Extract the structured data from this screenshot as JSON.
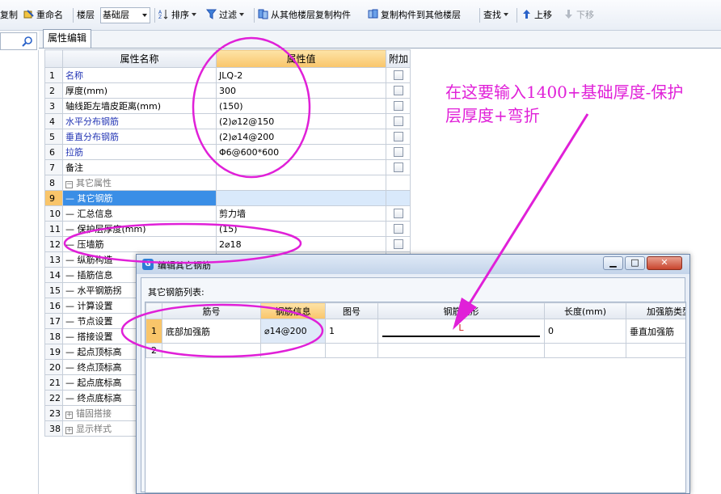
{
  "toolbar": {
    "copy": "复制",
    "rename": "重命名",
    "floor_label": "楼层",
    "floor_value": "基础层",
    "sort": "排序",
    "filter": "过滤",
    "copy_from_other_floor": "从其他楼层复制构件",
    "copy_to_other_floor": "复制构件到其他楼层",
    "find": "查找",
    "move_up": "上移",
    "move_down": "下移"
  },
  "tab": {
    "label": "属性编辑"
  },
  "grid": {
    "headers": {
      "name": "属性名称",
      "value": "属性值",
      "extra": "附加"
    },
    "rows": [
      {
        "num": "1",
        "name": "名称",
        "value": "JLQ-2"
      },
      {
        "num": "2",
        "name": "厚度(mm)",
        "value": "300"
      },
      {
        "num": "3",
        "name": "轴线距左墙皮距离(mm)",
        "value": "(150)"
      },
      {
        "num": "4",
        "name": "水平分布钢筋",
        "value": "(2)⌀12@150"
      },
      {
        "num": "5",
        "name": "垂直分布钢筋",
        "value": "(2)⌀14@200"
      },
      {
        "num": "6",
        "name": "拉筋",
        "value": "Φ6@600*600"
      },
      {
        "num": "7",
        "name": "备注",
        "value": ""
      },
      {
        "num": "8",
        "name": "其它属性",
        "value": ""
      },
      {
        "num": "9",
        "name": "其它钢筋",
        "value": ""
      },
      {
        "num": "10",
        "name": "汇总信息",
        "value": "剪力墙"
      },
      {
        "num": "11",
        "name": "保护层厚度(mm)",
        "value": "(15)"
      },
      {
        "num": "12",
        "name": "压墙筋",
        "value": "2⌀18"
      },
      {
        "num": "13",
        "name": "纵筋构造",
        "value": ""
      },
      {
        "num": "14",
        "name": "插筋信息",
        "value": ""
      },
      {
        "num": "15",
        "name": "水平钢筋拐",
        "value": ""
      },
      {
        "num": "16",
        "name": "计算设置",
        "value": ""
      },
      {
        "num": "17",
        "name": "节点设置",
        "value": ""
      },
      {
        "num": "18",
        "name": "搭接设置",
        "value": ""
      },
      {
        "num": "19",
        "name": "起点顶标高",
        "value": ""
      },
      {
        "num": "20",
        "name": "终点顶标高",
        "value": ""
      },
      {
        "num": "21",
        "name": "起点底标高",
        "value": ""
      },
      {
        "num": "22",
        "name": "终点底标高",
        "value": ""
      },
      {
        "num": "23",
        "name": "锚固搭接",
        "value": ""
      },
      {
        "num": "38",
        "name": "显示样式",
        "value": ""
      }
    ]
  },
  "annotation": {
    "line1": "在这要输入1400+基础厚度-保护",
    "line2": "层厚度+弯折"
  },
  "dialog": {
    "title": "编辑其它钢筋",
    "list_label": "其它钢筋列表:",
    "headers": {
      "bar_no": "筋号",
      "bar_info": "钢筋信息",
      "shape_no": "图号",
      "shape": "钢筋图形",
      "length": "长度(mm)",
      "type": "加强筋类型"
    },
    "rows": [
      {
        "num": "1",
        "bar_no": "底部加强筋",
        "bar_info": "⌀14@200",
        "shape_no": "1",
        "shape_label": "L",
        "length": "0",
        "type": "垂直加强筋"
      },
      {
        "num": "2",
        "bar_no": "",
        "bar_info": "",
        "shape_no": "",
        "shape_label": "",
        "length": "",
        "type": ""
      }
    ]
  },
  "colors": {
    "annotation": "#e020d8",
    "accent_header": "#f9c56a",
    "selection": "#3a8ee6"
  }
}
